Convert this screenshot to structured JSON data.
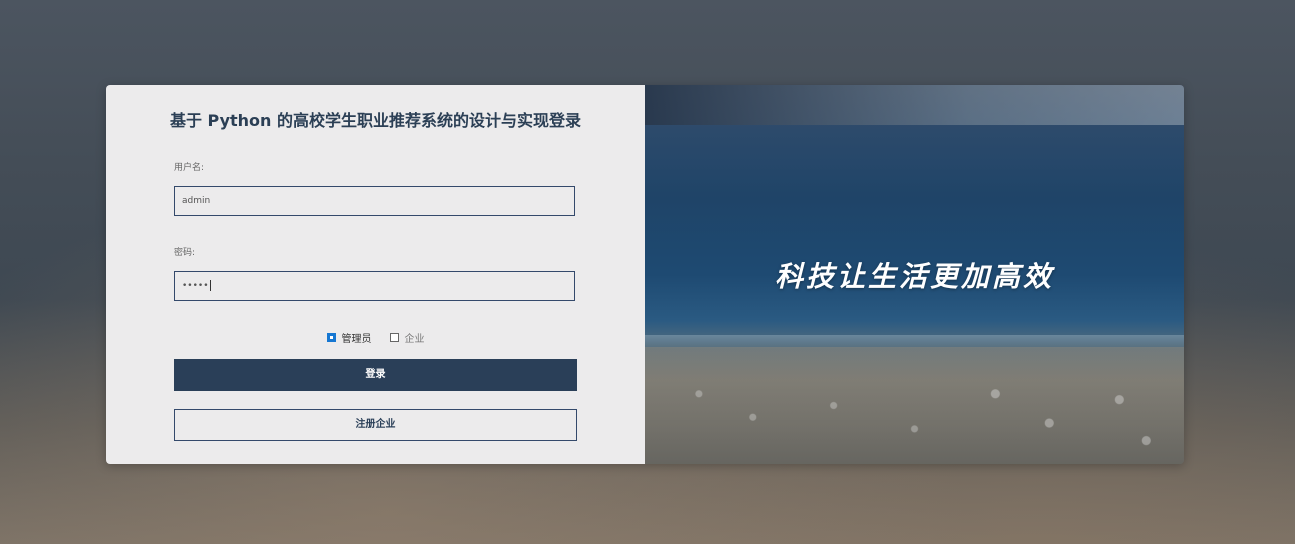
{
  "login": {
    "title": "基于 Python 的高校学生职业推荐系统的设计与实现登录",
    "username_label": "用户名:",
    "username_value": "admin",
    "password_label": "密码:",
    "password_value": "•••••",
    "roles": [
      {
        "label": "管理员",
        "checked": true
      },
      {
        "label": "企业",
        "checked": false
      }
    ],
    "login_button": "登录",
    "register_button": "注册企业"
  },
  "hero": {
    "slogan": "科技让生活更加高效"
  },
  "colors": {
    "primary": "#2a3f58",
    "checkbox_accent": "#1677d2",
    "panel_bg": "#ecebec"
  }
}
